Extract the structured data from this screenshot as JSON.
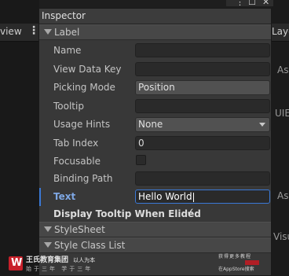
{
  "background": {
    "left_tab_text": "view",
    "left_menu_glyph": "⋮",
    "right_tab_text": "Laye",
    "right_labels": [
      "As",
      "UIE",
      "As",
      "Visu"
    ]
  },
  "window_controls": {
    "menu_glyph": "⋮",
    "maximize_glyph": "☐",
    "close_glyph": "✕"
  },
  "inspector": {
    "title": "Inspector",
    "label_section": {
      "title": "Label",
      "rows": [
        {
          "label": "Name",
          "kind": "text",
          "value": ""
        },
        {
          "label": "View Data Key",
          "kind": "text",
          "value": ""
        },
        {
          "label": "Picking Mode",
          "kind": "dropdown",
          "value": "Position"
        },
        {
          "label": "Tooltip",
          "kind": "text",
          "value": ""
        },
        {
          "label": "Usage Hints",
          "kind": "dropdown",
          "value": "None"
        },
        {
          "label": "Tab Index",
          "kind": "text",
          "value": "0"
        },
        {
          "label": "Focusable",
          "kind": "checkbox",
          "value": false
        },
        {
          "label": "Binding Path",
          "kind": "text",
          "value": ""
        },
        {
          "label": "Text",
          "kind": "text",
          "value": "Hello World",
          "focused": true
        },
        {
          "label": "Display Tooltip When Elided",
          "kind": "checkbox",
          "value": true
        }
      ]
    },
    "stylesheet_section": {
      "title": "StyleSheet"
    },
    "style_class_section": {
      "title": "Style Class List"
    }
  },
  "watermark": {
    "logo_glyph": "W",
    "name": "王氏教育集团",
    "name_suffix": "以人为本",
    "subtitle": "始于三年 学于三年",
    "right_line1": "获得更多教程",
    "right_line2": "在AppStore搜索"
  },
  "colors": {
    "accent": "#3a79d6",
    "panel_bg": "#383838",
    "field_bg": "#2a2a2a",
    "dropdown_bg": "#515151"
  }
}
